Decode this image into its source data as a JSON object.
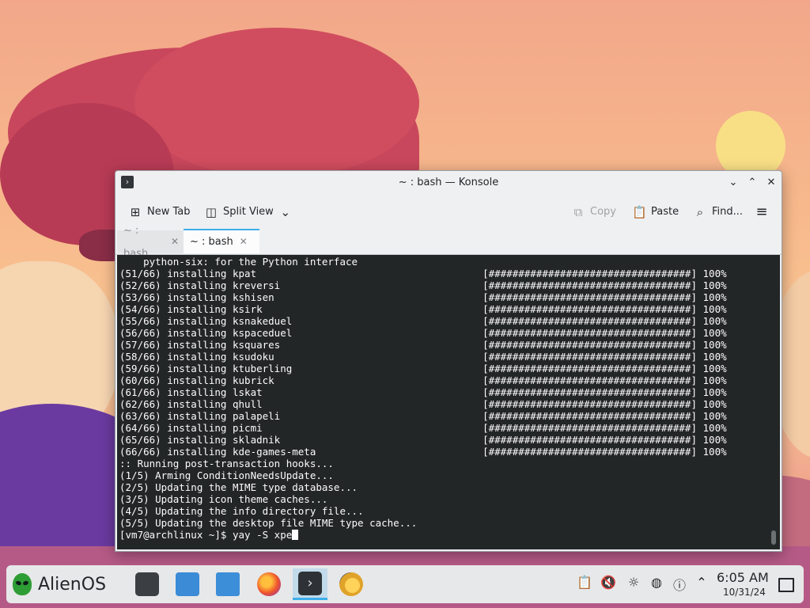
{
  "window": {
    "title": "~ : bash — Konsole",
    "toolbar": {
      "new_tab": "New Tab",
      "split_view": "Split View",
      "copy": "Copy",
      "paste": "Paste",
      "find": "Find..."
    },
    "tabs": [
      {
        "label": "~ : bash",
        "active": false
      },
      {
        "label": "~ : bash",
        "active": true
      }
    ]
  },
  "terminal": {
    "lines": [
      "    python-six: for the Python interface",
      "(51/66) installing kpat                                      [##################################] 100%",
      "(52/66) installing kreversi                                  [##################################] 100%",
      "(53/66) installing kshisen                                   [##################################] 100%",
      "(54/66) installing ksirk                                     [##################################] 100%",
      "(55/66) installing ksnakeduel                                [##################################] 100%",
      "(56/66) installing kspaceduel                                [##################################] 100%",
      "(57/66) installing ksquares                                  [##################################] 100%",
      "(58/66) installing ksudoku                                   [##################################] 100%",
      "(59/66) installing ktuberling                                [##################################] 100%",
      "(60/66) installing kubrick                                   [##################################] 100%",
      "(61/66) installing lskat                                     [##################################] 100%",
      "(62/66) installing qhull                                     [##################################] 100%",
      "(63/66) installing palapeli                                  [##################################] 100%",
      "(64/66) installing picmi                                     [##################################] 100%",
      "(65/66) installing skladnik                                  [##################################] 100%",
      "(66/66) installing kde-games-meta                            [##################################] 100%",
      ":: Running post-transaction hooks...",
      "(1/5) Arming ConditionNeedsUpdate...",
      "(2/5) Updating the MIME type database...",
      "(3/5) Updating icon theme caches...",
      "(4/5) Updating the info directory file...",
      "(5/5) Updating the desktop file MIME type cache..."
    ],
    "prompt": "[vm7@archlinux ~]$ yay -S xpe"
  },
  "taskbar": {
    "launcher_label": "AlienOS",
    "time": "6:05 AM",
    "date": "10/31/24",
    "apps": [
      "settings-icon",
      "discover-icon",
      "file-manager-icon",
      "firefox-icon",
      "konsole-icon",
      "updater-icon"
    ],
    "tray": [
      "clipboard-icon",
      "volume-muted-icon",
      "brightness-icon",
      "network-icon",
      "help-icon",
      "expand-tray-icon"
    ]
  }
}
